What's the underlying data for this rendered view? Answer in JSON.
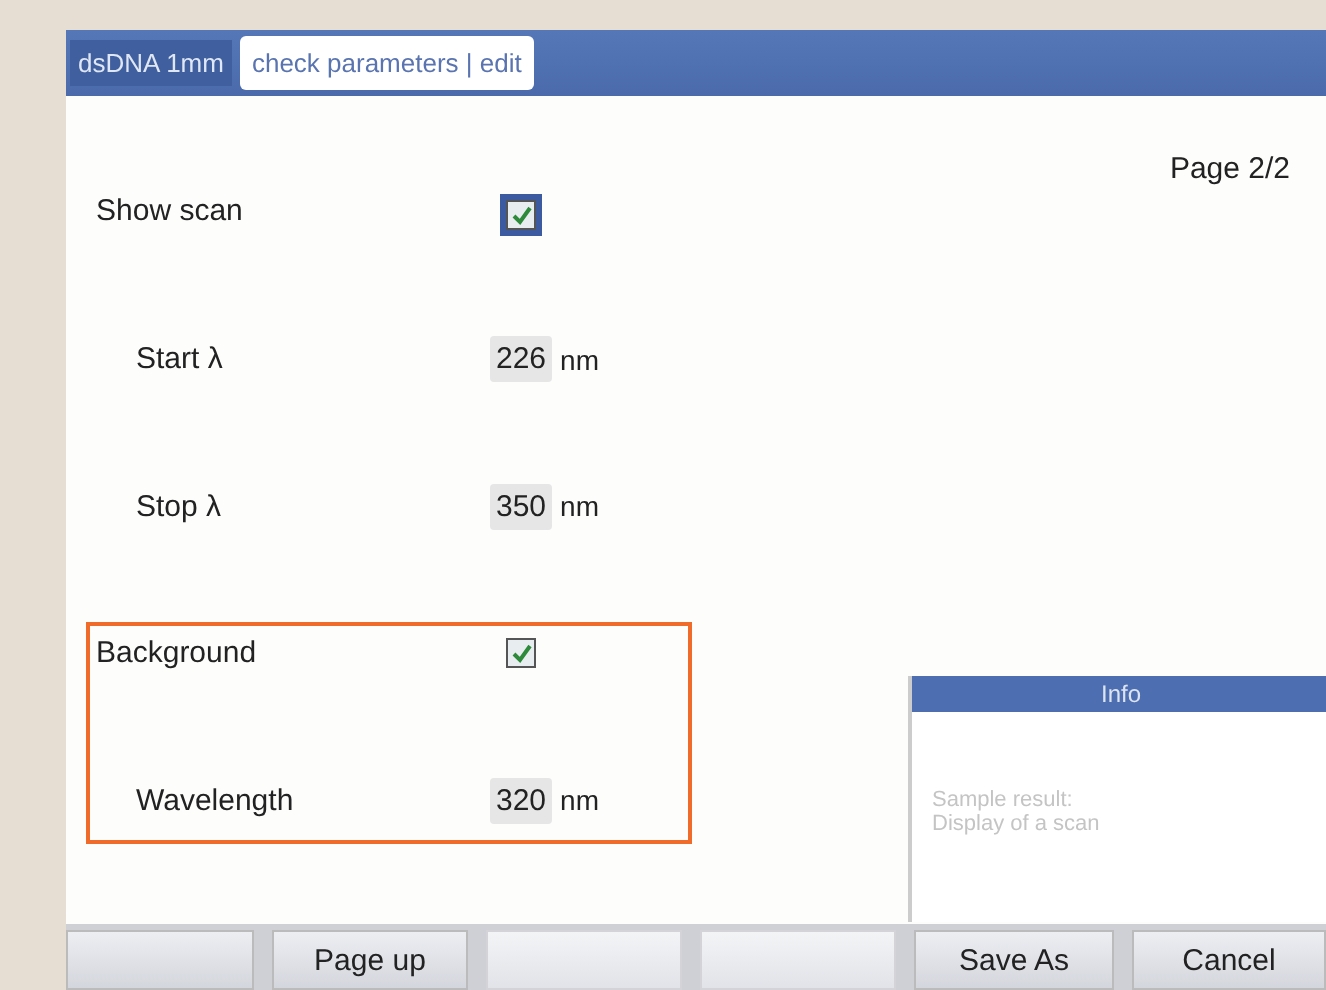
{
  "title_bar": {
    "tabs": [
      {
        "label": "dsDNA 1mm",
        "selected": false
      },
      {
        "label": "check parameters | edit",
        "selected": true
      }
    ]
  },
  "page_indicator": "Page 2/2",
  "parameters": [
    {
      "kind": "checkbox",
      "label": "Show scan",
      "indented": false,
      "checked": true,
      "focused": true
    },
    {
      "kind": "value",
      "label": "Start λ",
      "indented": true,
      "value": "226",
      "unit": "nm"
    },
    {
      "kind": "value",
      "label": "Stop λ",
      "indented": true,
      "value": "350",
      "unit": "nm"
    },
    {
      "kind": "checkbox",
      "label": "Background",
      "indented": false,
      "checked": true,
      "focused": false
    },
    {
      "kind": "value",
      "label": "Wavelength",
      "indented": true,
      "value": "320",
      "unit": "nm"
    }
  ],
  "info_dialog": {
    "title": "Info",
    "lines": [
      "Sample result:",
      "Display of a scan"
    ]
  },
  "buttons": [
    {
      "disabled": false
    },
    {
      "label": "Page up",
      "disabled": false
    },
    {
      "disabled": true
    },
    {
      "disabled": true
    },
    {
      "label": "Save As",
      "disabled": false
    },
    {
      "label": "Cancel",
      "disabled": false
    }
  ]
}
